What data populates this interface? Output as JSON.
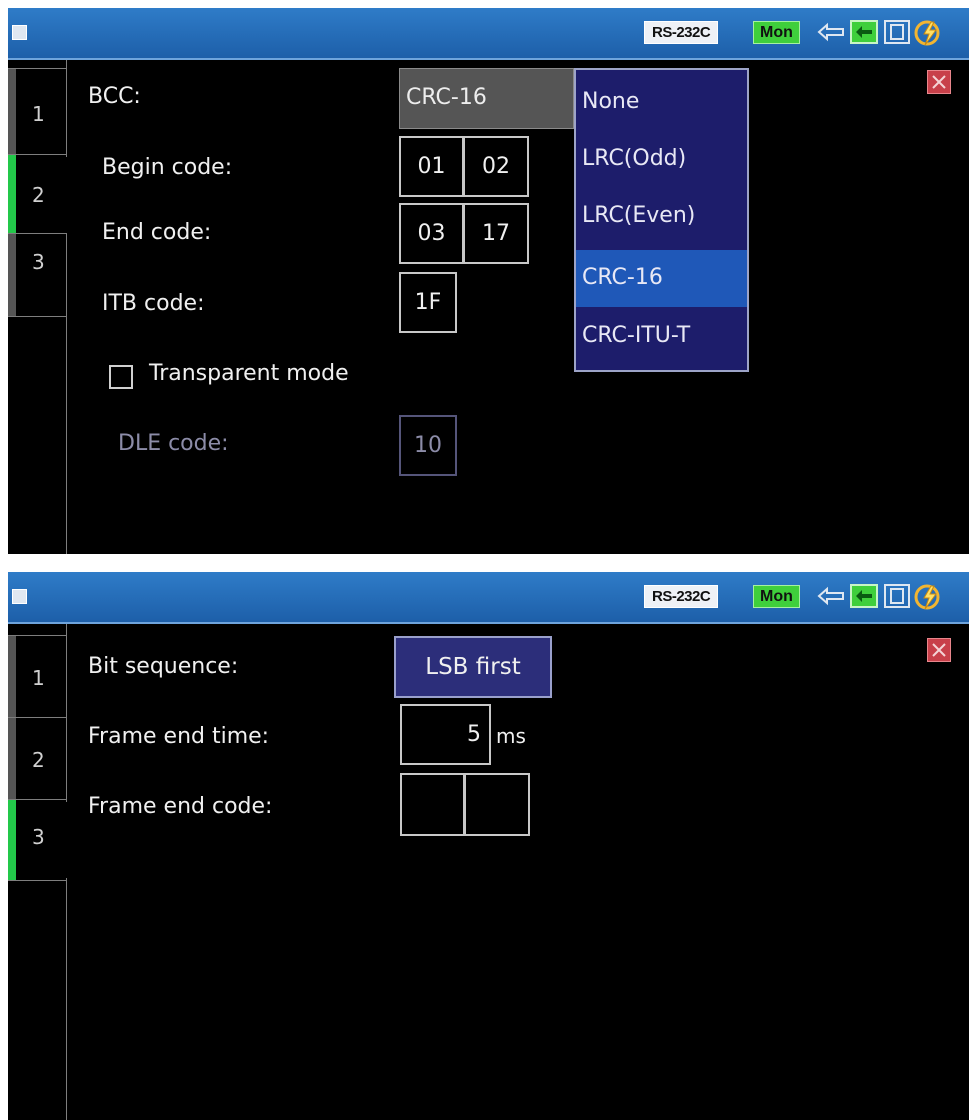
{
  "status": {
    "interface": "RS-232C",
    "monitor": "Mon"
  },
  "screen1": {
    "tabs": [
      "1",
      "2",
      "3"
    ],
    "active_tab": "2",
    "bcc_label": "BCC:",
    "bcc_value": "CRC-16",
    "bcc_options": [
      "None",
      "LRC(Odd)",
      "LRC(Even)",
      "CRC-16",
      "CRC-ITU-T"
    ],
    "bcc_selected": "CRC-16",
    "begin_code_label": "Begin code:",
    "begin_code": [
      "01",
      "02"
    ],
    "end_code_label": "End code:",
    "end_code": [
      "03",
      "17"
    ],
    "itb_code_label": "ITB code:",
    "itb_code": "1F",
    "transparent_mode_label": "Transparent mode",
    "transparent_mode_checked": false,
    "dle_code_label": "DLE code:",
    "dle_code": "10"
  },
  "screen2": {
    "tabs": [
      "1",
      "2",
      "3"
    ],
    "active_tab": "3",
    "bit_sequence_label": "Bit sequence:",
    "bit_sequence_value": "LSB first",
    "frame_end_time_label": "Frame end time:",
    "frame_end_time_value": "5",
    "frame_end_time_unit": "ms",
    "frame_end_code_label": "Frame end code:",
    "frame_end_code": [
      "",
      ""
    ]
  },
  "colors": {
    "titlebar": "#1f63ad",
    "active_tab": "#23c84a",
    "mon_badge": "#3fcf3c",
    "dropdown_bg": "#1d1d6b",
    "dropdown_selected": "#1f58b8",
    "close": "#c8404a"
  },
  "icons": [
    "window-icon",
    "usb-icon",
    "port-icon",
    "document-icon",
    "power-icon",
    "close-icon"
  ]
}
